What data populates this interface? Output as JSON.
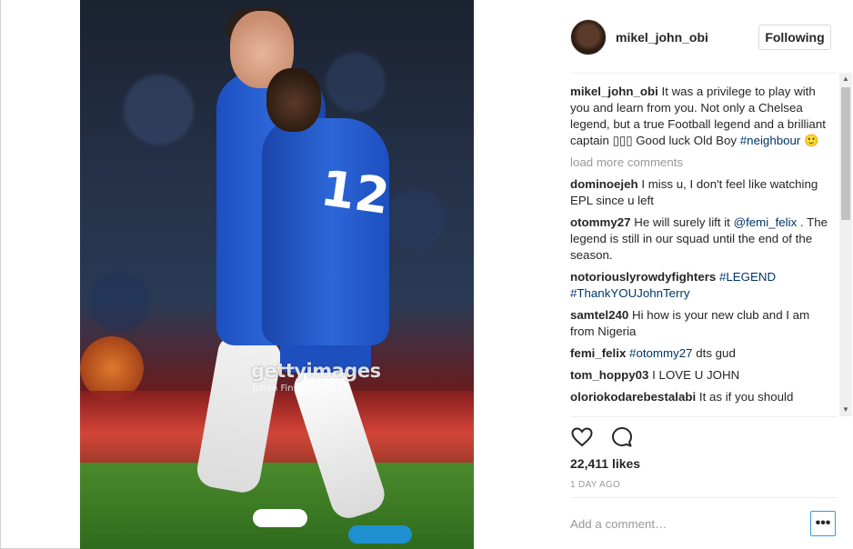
{
  "post": {
    "watermark": "gettyimages",
    "photo_credit": "Julian Finney · The FA",
    "jersey_number": "12"
  },
  "header": {
    "username": "mikel_john_obi",
    "follow_label": "Following"
  },
  "caption": {
    "username": "mikel_john_obi",
    "text": "It was a privilege to play with you and learn from you. Not only a Chelsea legend, but a true Football legend and a brilliant captain ▯▯▯ Good luck Old Boy ",
    "hashtag": "#neighbour",
    "emoji": "🙂"
  },
  "load_more_label": "load more comments",
  "comments": [
    {
      "username": "dominoejeh",
      "text": "I miss u, I don't feel like watching EPL since u left"
    },
    {
      "username": "otommy27",
      "text_before": "He will surely lift it ",
      "mention": "@femi_felix",
      "text_after": " . The legend is still in our squad until the end of the season."
    },
    {
      "username": "notoriouslyrowdyfighters",
      "hashtags": "#LEGEND #ThankYOUJohnTerry"
    },
    {
      "username": "samtel240",
      "text": "Hi how is your new club and I am from Nigeria"
    },
    {
      "username": "femi_felix",
      "mention": "#otommy27",
      "text_after": " dts gud"
    },
    {
      "username": "tom_hoppy03",
      "text": "I LOVE U JOHN"
    },
    {
      "username": "oloriokodarebestalabi",
      "text": "It as if you should"
    }
  ],
  "actions": {
    "like_icon": "heart-icon",
    "comment_icon": "speech-bubble-icon"
  },
  "likes": "22,411 likes",
  "timestamp": "1 DAY AGO",
  "add_comment_placeholder": "Add a comment…",
  "more_label": "•••",
  "scrollbar": {
    "up": "▲",
    "down": "▼"
  }
}
